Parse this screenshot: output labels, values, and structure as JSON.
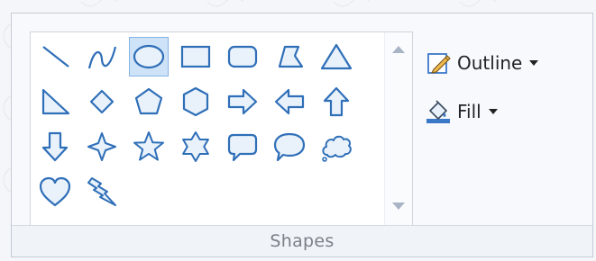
{
  "group": {
    "label": "Shapes"
  },
  "commands": {
    "outline": {
      "label": "Outline",
      "icon": "pencil-outline-icon"
    },
    "fill": {
      "label": "Fill",
      "icon": "paint-bucket-icon"
    }
  },
  "gallery": {
    "selected": "oval",
    "shapes": [
      "line",
      "curve",
      "oval",
      "rectangle",
      "rounded-rectangle",
      "polygon",
      "triangle",
      "right-triangle",
      "diamond",
      "pentagon",
      "hexagon",
      "right-arrow",
      "left-arrow",
      "up-arrow",
      "down-arrow",
      "four-point-star",
      "five-point-star",
      "six-point-star",
      "rounded-rectangular-callout",
      "oval-callout",
      "cloud-callout",
      "heart",
      "lightning"
    ]
  },
  "colors": {
    "shape_stroke": "#2f6fb8",
    "shape_fill": "#e9f2fb",
    "selection": "#cfe3f8"
  }
}
